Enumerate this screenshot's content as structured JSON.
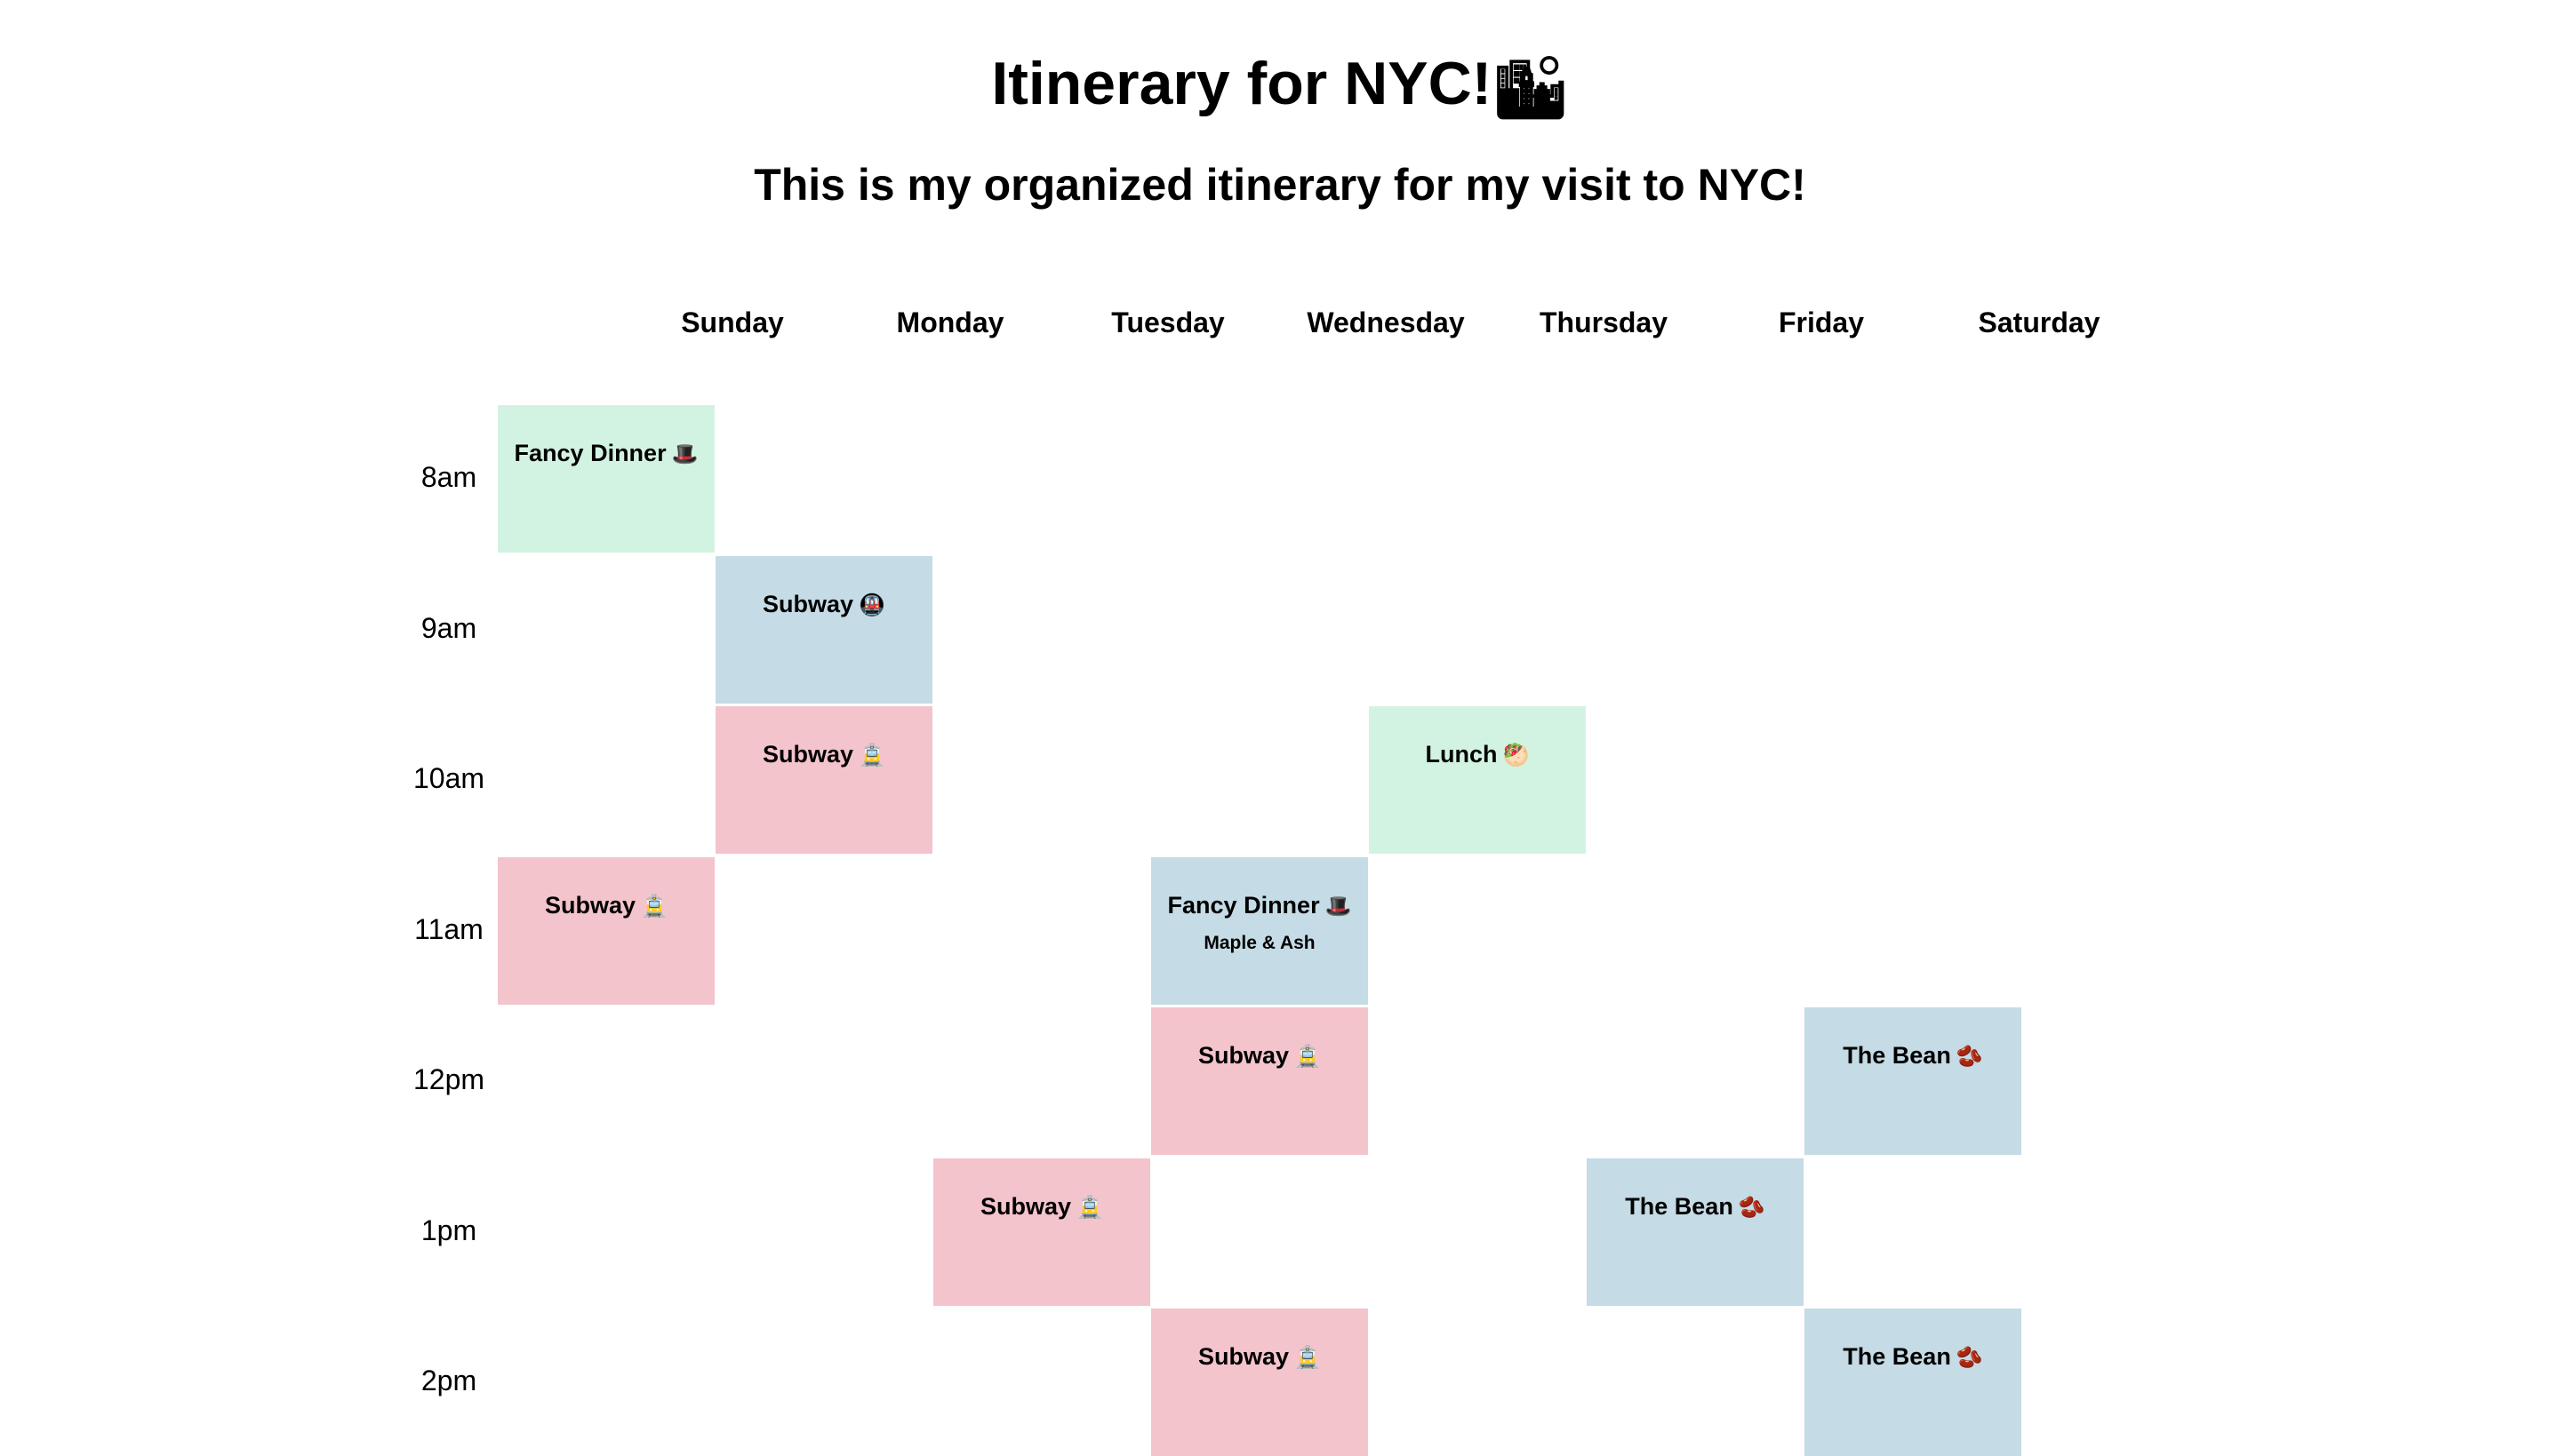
{
  "header": {
    "title": "Itinerary for NYC!",
    "title_emoji": "🏙",
    "subtitle": "This is my organized itinerary for my visit to NYC!"
  },
  "days": [
    "Sunday",
    "Monday",
    "Tuesday",
    "Wednesday",
    "Thursday",
    "Friday",
    "Saturday"
  ],
  "times": [
    "8am",
    "9am",
    "10am",
    "11am",
    "12pm",
    "1pm",
    "2pm"
  ],
  "colors": {
    "green": "#d3f3e2",
    "blue": "#c5dbe5",
    "pink": "#f4c4cd"
  },
  "events": [
    {
      "title": "Fancy Dinner",
      "emoji": "🎩",
      "color": "green",
      "day": "Sunday",
      "time": "8am"
    },
    {
      "title": "Subway",
      "emoji": "🚇",
      "color": "blue",
      "day": "Monday",
      "time": "9am"
    },
    {
      "title": "Subway",
      "emoji": "🚊",
      "color": "pink",
      "day": "Monday",
      "time": "10am"
    },
    {
      "title": "Lunch",
      "emoji": "🥙",
      "color": "green",
      "day": "Thursday",
      "time": "10am"
    },
    {
      "title": "Subway",
      "emoji": "🚊",
      "color": "pink",
      "day": "Sunday",
      "time": "11am"
    },
    {
      "title": "Fancy Dinner",
      "emoji": "🎩",
      "subtitle": "Maple & Ash",
      "color": "blue",
      "day": "Wednesday",
      "time": "11am"
    },
    {
      "title": "Subway",
      "emoji": "🚊",
      "color": "pink",
      "day": "Wednesday",
      "time": "12pm"
    },
    {
      "title": "The Bean",
      "emoji": "🫘",
      "color": "blue",
      "day": "Saturday",
      "time": "12pm"
    },
    {
      "title": "Subway",
      "emoji": "🚊",
      "color": "pink",
      "day": "Tuesday",
      "time": "1pm"
    },
    {
      "title": "The Bean",
      "emoji": "🫘",
      "color": "blue",
      "day": "Friday",
      "time": "1pm"
    },
    {
      "title": "Subway",
      "emoji": "🚊",
      "color": "pink",
      "day": "Wednesday",
      "time": "2pm"
    },
    {
      "title": "The Bean",
      "emoji": "🫘",
      "color": "blue",
      "day": "Saturday",
      "time": "2pm"
    }
  ]
}
